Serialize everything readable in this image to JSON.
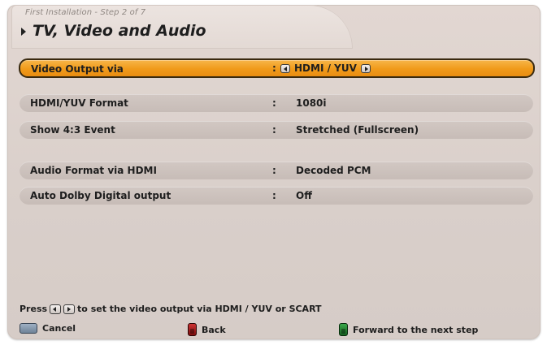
{
  "header": {
    "step": "First Installation - Step 2 of 7",
    "title": "TV, Video and Audio"
  },
  "settings": [
    {
      "label": "Video Output via",
      "value": "HDMI / YUV",
      "selected": true
    },
    {
      "label": "HDMI/YUV Format",
      "value": "1080i"
    },
    {
      "label": "Show 4:3 Event",
      "value": "Stretched (Fullscreen)"
    },
    {
      "label": "Audio Format via HDMI",
      "value": "Decoded PCM"
    },
    {
      "label": "Auto Dolby Digital output",
      "value": "Off"
    }
  ],
  "colon": ":",
  "hint": {
    "prefix": "Press",
    "suffix": "to set the video output via HDMI / YUV or SCART"
  },
  "footer": {
    "cancel": "Cancel",
    "back": "Back",
    "forward": "Forward to the next step"
  },
  "colors": {
    "selection": "#f09a1a",
    "panel": "#dcd2cd",
    "row": "#cbc1bc"
  },
  "icons": [
    "triangle-right-icon",
    "arrow-left-key-icon",
    "arrow-right-key-icon",
    "cancel-key-icon",
    "red-key-icon",
    "green-key-icon"
  ]
}
